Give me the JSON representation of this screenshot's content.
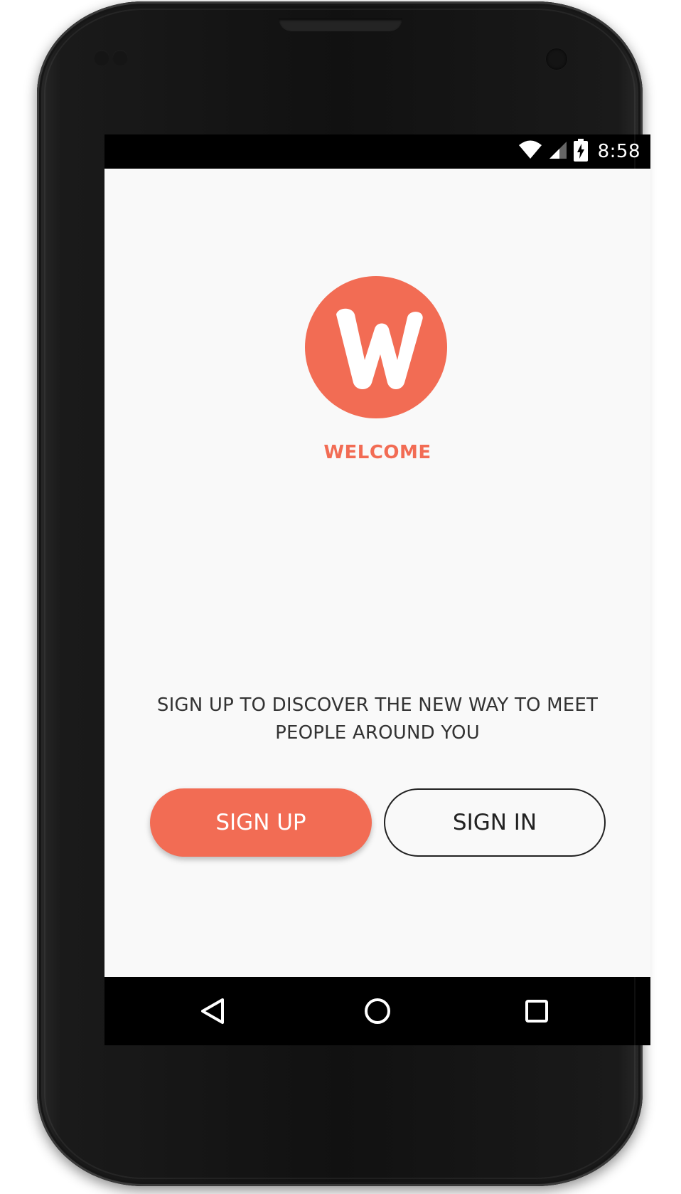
{
  "status_bar": {
    "time": "8:58",
    "icons": [
      "wifi-icon",
      "cell-signal-icon",
      "battery-charging-icon"
    ]
  },
  "app": {
    "logo_letter": "W",
    "welcome": "WELCOME",
    "tagline": "SIGN UP TO DISCOVER THE NEW WAY TO MEET PEOPLE AROUND YOU",
    "signup_label": "SIGN UP",
    "signin_label": "SIGN IN"
  },
  "nav_bar": {
    "icons": [
      "back-icon",
      "home-icon",
      "recents-icon"
    ]
  },
  "colors": {
    "accent": "#f26c54",
    "background": "#f9f9f9",
    "text": "#333333",
    "bars": "#000000"
  }
}
